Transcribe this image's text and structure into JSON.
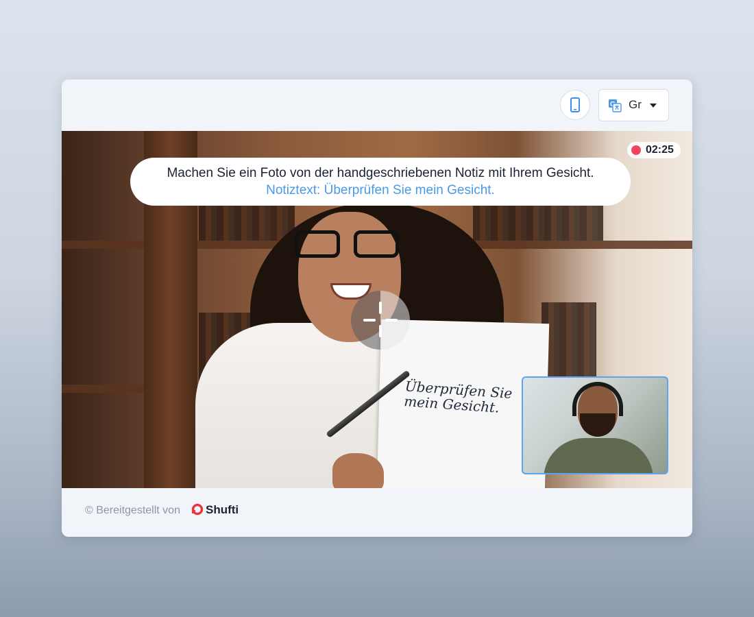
{
  "header": {
    "device_icon": "smartphone-icon",
    "language": {
      "icon": "translate-icon",
      "label": "Gr",
      "chevron_icon": "chevron-down-icon"
    }
  },
  "stage": {
    "instruction": {
      "text": "Machen Sie ein Foto von der handgeschriebenen Notiz mit Ihrem Gesicht.",
      "note_text": "Notiztext: Überprüfen Sie mein Gesicht."
    },
    "timer": {
      "recording_icon": "record-dot-icon",
      "time": "02:25"
    },
    "handwritten_note": "Überprüfen Sie mein Gesicht.",
    "focus_icon": "crosshair-icon"
  },
  "footer": {
    "credit": "© Bereitgestellt von",
    "brand": "Shufti",
    "brand_icon": "shufti-logo-icon"
  },
  "colors": {
    "accent": "#4a98e8",
    "recording": "#f0445e",
    "pip_border": "#5ea3ee",
    "brand": "#e8363c"
  }
}
